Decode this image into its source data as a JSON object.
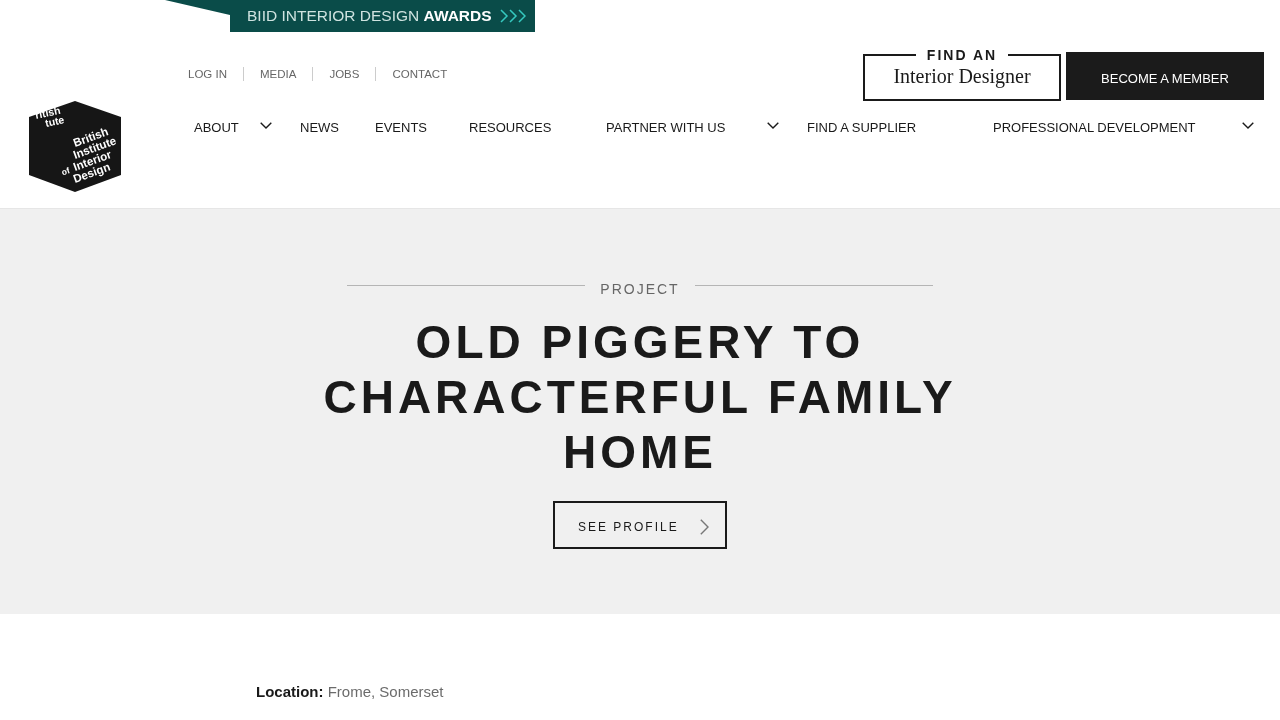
{
  "banner": {
    "text": "BIID INTERIOR DESIGN **AWARDS**"
  },
  "utility_links": [
    "LOG IN",
    "MEDIA",
    "JOBS",
    "CONTACT"
  ],
  "logo": {
    "top_lines": [
      "ritish",
      "tute"
    ],
    "front_lines": [
      {
        "text": "British"
      },
      {
        "text": "Institute"
      },
      {
        "text": "Interior",
        "prefix": "of"
      },
      {
        "text": "Design"
      }
    ]
  },
  "find_designer_button": {
    "kicker": "FIND AN",
    "label": "Interior Designer"
  },
  "member_button": "BECOME A MEMBER",
  "nav": [
    {
      "label": "ABOUT",
      "dropdown": true
    },
    {
      "label": "NEWS",
      "dropdown": false
    },
    {
      "label": "EVENTS",
      "dropdown": false
    },
    {
      "label": "RESOURCES",
      "dropdown": false
    },
    {
      "label": "PARTNER WITH US",
      "dropdown": true
    },
    {
      "label": "FIND A SUPPLIER",
      "dropdown": false
    },
    {
      "label": "PROFESSIONAL DEVELOPMENT",
      "dropdown": true
    }
  ],
  "hero": {
    "eyebrow": "PROJECT",
    "title": "OLD PIGGERY TO CHARACTERFUL FAMILY HOME",
    "button": "SEE PROFILE"
  },
  "details": [
    "**Location:** Frome, Somerset"
  ]
}
